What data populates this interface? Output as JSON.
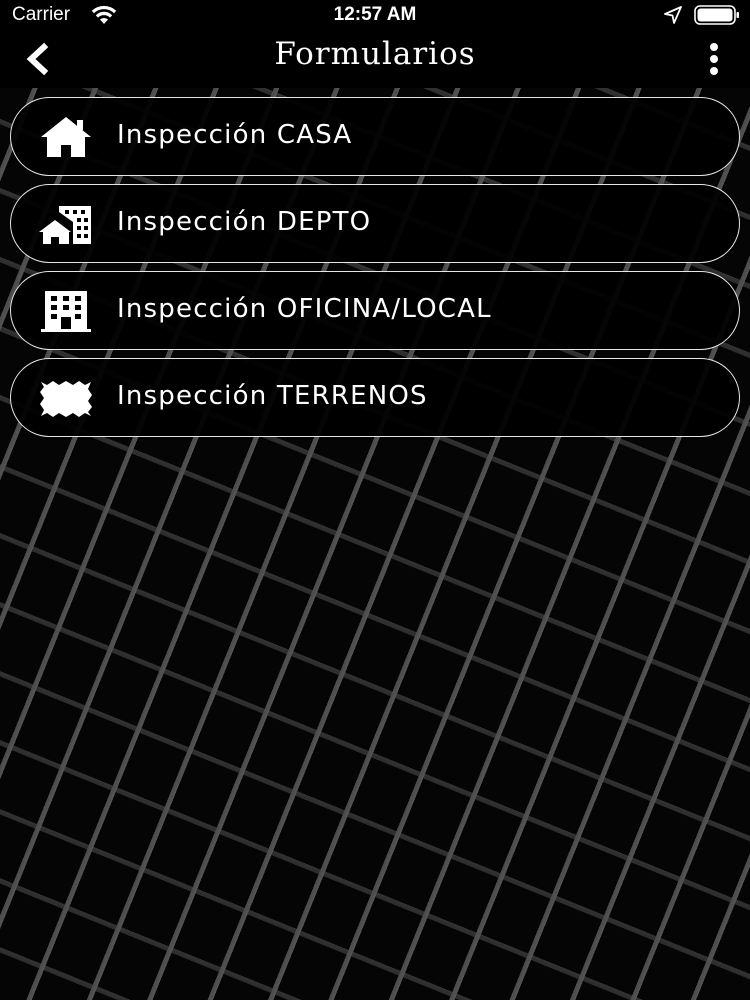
{
  "status_bar": {
    "carrier": "Carrier",
    "time": "12:57 AM",
    "icons": [
      "wifi-icon",
      "location-arrow-icon",
      "battery-icon"
    ]
  },
  "nav": {
    "title": "Formularios",
    "back_icon": "chevron-left-icon",
    "more_icon": "vertical-dots-icon"
  },
  "menu": {
    "items": [
      {
        "label": "Inspección CASA",
        "icon": "house-icon"
      },
      {
        "label": "Inspección DEPTO",
        "icon": "apartment-building-icon"
      },
      {
        "label": "Inspección OFICINA/LOCAL",
        "icon": "office-building-icon"
      },
      {
        "label": "Inspección TERRENOS",
        "icon": "land-plot-icon"
      }
    ]
  },
  "colors": {
    "background": "#000000",
    "text": "#ffffff",
    "item_border": "#e6e6e6",
    "pattern": "#4a4a4a"
  }
}
